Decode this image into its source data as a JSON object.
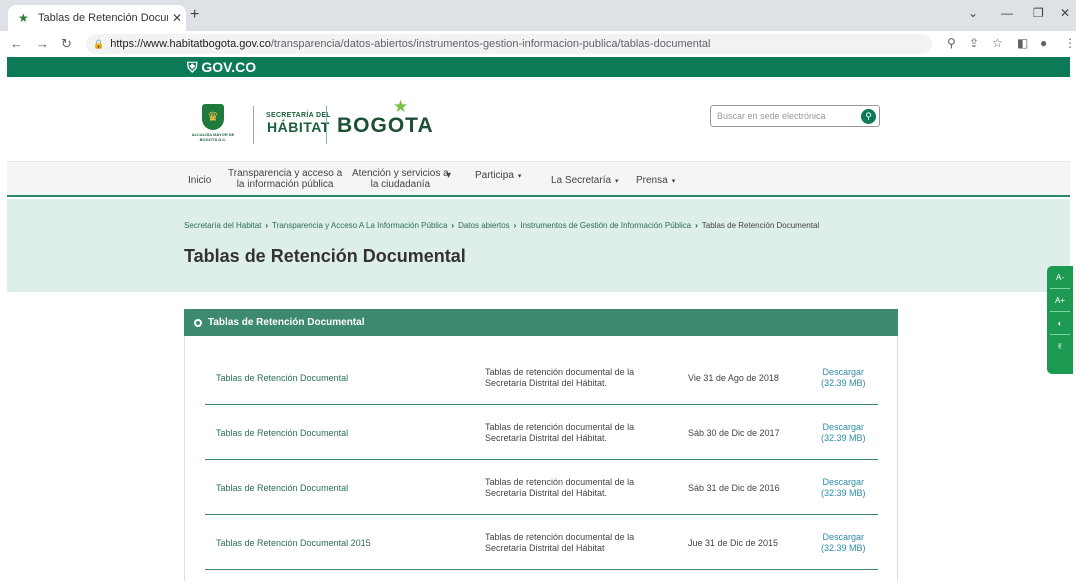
{
  "browser": {
    "tab_title": "Tablas de Retención Documental",
    "tab_icon": "bogota-star-icon",
    "url_host": "https://www.habitatbogota.gov.co",
    "url_path": "/transparencia/datos-abiertos/instrumentos-gestion-informacion-publica/tablas-documental"
  },
  "gov_bar": {
    "label": "GOV.CO"
  },
  "header": {
    "alcaldia_caption": "ALCALDÍA MAYOR DE BOGOTÁ D.C.",
    "secretaria_line1": "SECRETARÍA DEL",
    "secretaria_line2": "HÁBITAT",
    "bogota_logo": "BOGOTA",
    "search_placeholder": "Buscar en sede electrónica"
  },
  "menu": {
    "inicio": "Inicio",
    "transparencia_1": "Transparencia y acceso a",
    "transparencia_2": "la información pública",
    "atencion_1": "Atención y servicios a",
    "atencion_2": "la ciudadanía",
    "participa": "Participa",
    "secretaria": "La Secretaría",
    "prensa": "Prensa"
  },
  "breadcrumb": [
    "Secretaría del Habitat",
    "Transparencia y Acceso A La Información Pública",
    "Datos abiertos",
    "Instrumentos de Gestión de Información Pública",
    "Tablas de Retención Documental"
  ],
  "page_title": "Tablas de Retención Documental",
  "accordion": {
    "title": "Tablas de Retención Documental"
  },
  "rows": [
    {
      "name": "Tablas de Retención Documental",
      "desc1": "Tablas de retención documental de la",
      "desc2": "Secretaría Distrital del Hábitat.",
      "date": "Vie 31 de Ago de 2018",
      "dl1": "Descargar",
      "dl2": "(32.39 MB)"
    },
    {
      "name": "Tablas de Retención Documental",
      "desc1": "Tablas de retención documental de la",
      "desc2": "Secretaría Distrital del Hábitat.",
      "date": "Sáb 30 de Dic de 2017",
      "dl1": "Descargar",
      "dl2": "(32.39 MB)"
    },
    {
      "name": "Tablas de Retención Documental",
      "desc1": "Tablas de retención documental de la",
      "desc2": "Secretaría Distrital del Hábitat.",
      "date": "Sáb 31 de Dic de 2016",
      "dl1": "Descargar",
      "dl2": "(32.39 MB)"
    },
    {
      "name": "Tablas de Retención Documental 2015",
      "desc1": "Tablas de retención documental de la",
      "desc2": "Secretaría Distrital del Hábitat",
      "date": "Jue 31 de Dic de 2015",
      "dl1": "Descargar",
      "dl2": "(32.39 MB)"
    }
  ],
  "accessibility": {
    "decrease": "A-",
    "increase": "A+"
  },
  "colors": {
    "gov_green": "#0c7a57",
    "accordion": "#3e8a6e",
    "band": "#deeeeb",
    "access_bar": "#1d9a52"
  }
}
